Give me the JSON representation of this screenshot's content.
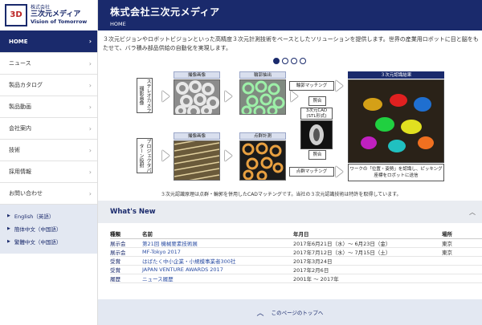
{
  "logo": {
    "seal_text": "3D",
    "line1": "株式会社",
    "line2": "三次元メディア",
    "line3": "Vision of Tomorrow"
  },
  "header": {
    "title": "株式会社三次元メディア",
    "breadcrumb": "HOME"
  },
  "sidebar": {
    "items": [
      {
        "label": "HOME",
        "active": true
      },
      {
        "label": "ニュース"
      },
      {
        "label": "製品カタログ"
      },
      {
        "label": "製品動画"
      },
      {
        "label": "会社案内"
      },
      {
        "label": "技術"
      },
      {
        "label": "採用情報"
      },
      {
        "label": "お問い合わせ"
      }
    ],
    "languages": [
      "English（英語）",
      "簡体中文（中国語）",
      "繁體中文（中国語）"
    ]
  },
  "intro": "３次元ビジョンやロボットビジョンといった高精度３次元計測技術をベースとしたソリューションを提供します。世界の産業用ロボットに目と脳をもたせて、バラ積み部品供給の自動化を実現します。",
  "carousel": {
    "dots": 4,
    "active": 0
  },
  "diagram": {
    "top_left_label": "ステレオカメラ撮影画像",
    "bottom_left_label": "プロジェクタパターン投射",
    "photo1_label": "撮像画像",
    "photo2_label": "輪郭抽出",
    "photo3_label": "撮像画像",
    "photo4_label": "点群計測",
    "match_top": "輪郭マッチング",
    "match_bottom": "点群マッチング",
    "collate_top": "照合",
    "collate_bottom": "照合",
    "cad_label": "3次元CAD\n(STL形式)",
    "result_label": "３次元認識結果",
    "result_note": "ワークの「位置・姿勢」を認識し、ピッキング座標をロボットに送信"
  },
  "caption": "３次元認識原理は点群・輪郭を併用したCADマッチングです。当社の３次元認識技術は特許を取得しています。",
  "news": {
    "title": "What's New",
    "columns": [
      "種類",
      "名前",
      "年月日",
      "場所"
    ],
    "rows": [
      {
        "type": "展示会",
        "name": "第21回 機械要素技術展",
        "date": "2017年6月21日（水）～ 6月23日（金）",
        "place": "東京"
      },
      {
        "type": "展示会",
        "name": "MF-Tokyo 2017",
        "date": "2017年7月12日（水）～ 7月15日（土）",
        "place": "東京"
      },
      {
        "type": "受賞",
        "name": "はばたく中小企業・小規模事業者300社",
        "date": "2017年3月24日",
        "place": ""
      },
      {
        "type": "受賞",
        "name": "JAPAN VENTURE AWARDS 2017",
        "date": "2017年2月6日",
        "place": ""
      },
      {
        "type": "履歴",
        "name": "ニュース履歴",
        "date": "2001年 ～ 2017年",
        "place": ""
      }
    ]
  },
  "footer": {
    "to_top": "このページのトップへ"
  },
  "colors": {
    "brand": "#1a2a6c",
    "link": "#2c4ea3",
    "lang_bg": "#e3e8f2"
  }
}
